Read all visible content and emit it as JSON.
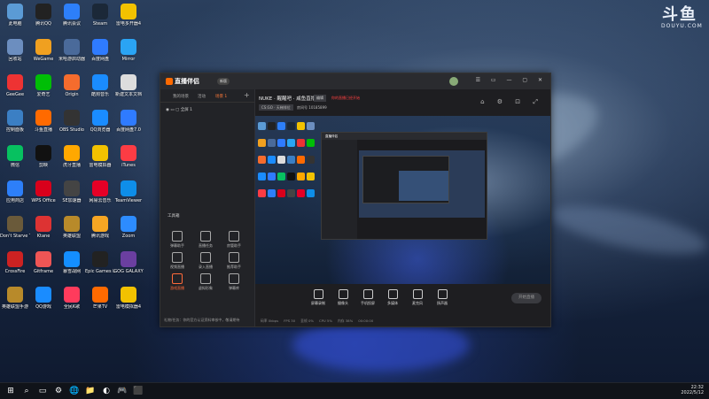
{
  "watermark": {
    "mark": "斗鱼",
    "sub": "DOUYU.COM"
  },
  "desktop_icons": [
    {
      "label": "此电脑",
      "color": "#5b9bd5"
    },
    {
      "label": "腾讯QQ",
      "color": "#222"
    },
    {
      "label": "腾讯会议",
      "color": "#2d7ff9"
    },
    {
      "label": "Steam",
      "color": "#1b2838"
    },
    {
      "label": "雷电多开器4",
      "color": "#f2c200"
    },
    {
      "label": "回收站",
      "color": "#6c8ebf"
    },
    {
      "label": "WeGame",
      "color": "#f0a020"
    },
    {
      "label": "米哈游启动器",
      "color": "#4a6a9a"
    },
    {
      "label": "百度网盘",
      "color": "#2f7bff"
    },
    {
      "label": "Mirror",
      "color": "#2aa4f4"
    },
    {
      "label": "GeeGee",
      "color": "#e33"
    },
    {
      "label": "爱奇艺",
      "color": "#00be06"
    },
    {
      "label": "Origin",
      "color": "#f56c2d"
    },
    {
      "label": "酷狗音乐",
      "color": "#1a8cff"
    },
    {
      "label": "新建文本文档",
      "color": "#ddd"
    },
    {
      "label": "控制面板",
      "color": "#3b7fc4"
    },
    {
      "label": "斗鱼直播",
      "color": "#ff6a00"
    },
    {
      "label": "OBS Studio",
      "color": "#333"
    },
    {
      "label": "QQ浏览器",
      "color": "#1a8cff"
    },
    {
      "label": "百度网盘7.0",
      "color": "#2f7bff"
    },
    {
      "label": "微信",
      "color": "#07c160"
    },
    {
      "label": "剪映",
      "color": "#111"
    },
    {
      "label": "虎牙直播",
      "color": "#ffa800"
    },
    {
      "label": "雷电模拟器",
      "color": "#f2c200"
    },
    {
      "label": "iTunes",
      "color": "#fc3c44"
    },
    {
      "label": "应用商店",
      "color": "#2d7ff9"
    },
    {
      "label": "WPS Office",
      "color": "#d9001b"
    },
    {
      "label": "SE加速器",
      "color": "#444"
    },
    {
      "label": "网易云音乐",
      "color": "#e60026"
    },
    {
      "label": "TeamViewer",
      "color": "#0e8ee9"
    },
    {
      "label": "Don't Starve Together",
      "color": "#6a5a3a"
    },
    {
      "label": "Ktane",
      "color": "#d33"
    },
    {
      "label": "英雄联盟",
      "color": "#b88a2a"
    },
    {
      "label": "腾讯游戏",
      "color": "#f6a623"
    },
    {
      "label": "Zoom",
      "color": "#2d8cff"
    },
    {
      "label": "CrossFire",
      "color": "#c22"
    },
    {
      "label": "Gitframe",
      "color": "#e55"
    },
    {
      "label": "暴雪战网",
      "color": "#148eff"
    },
    {
      "label": "Epic Games Launcher",
      "color": "#222"
    },
    {
      "label": "GOG GALAXY",
      "color": "#6b3fa0"
    },
    {
      "label": "英雄联盟手游",
      "color": "#b88a2a"
    },
    {
      "label": "QQ游戏",
      "color": "#1a8cff"
    },
    {
      "label": "全民K歌",
      "color": "#ff3b5c"
    },
    {
      "label": "芒果TV",
      "color": "#ff6a00"
    },
    {
      "label": "雷电模拟器4",
      "color": "#f2c200"
    }
  ],
  "app": {
    "logo": "直播伴侣",
    "version": "新版",
    "tabs": [
      "我的场景",
      "活动",
      "场景 1"
    ],
    "scene_label": "全屏 1",
    "tools_title": "工具箱",
    "tools": [
      {
        "label": "弹幕助手"
      },
      {
        "label": "直播任务"
      },
      {
        "label": "房管助手"
      },
      {
        "label": "视频直播"
      },
      {
        "label": "录入直播"
      },
      {
        "label": "推荐助手"
      },
      {
        "label": "游戏直播"
      },
      {
        "label": "虚拟形象"
      },
      {
        "label": "弹幕库"
      }
    ],
    "status_text": "礼物/任务：你的官方认证资料审核中，敬请期待",
    "room_title": "NUKE · 醒醒吧 · 咸鱼直播",
    "edit_label": "编辑",
    "warning_text": "你的直播已经开始",
    "category_chip": "CS:GO · 天梯排位",
    "room_info": "房间号 10185899",
    "bottom_buttons": [
      {
        "label": "屏幕录制"
      },
      {
        "label": "摄像头"
      },
      {
        "label": "手机投屏"
      },
      {
        "label": "多媒体"
      },
      {
        "label": "麦克风"
      },
      {
        "label": "扬声器"
      }
    ],
    "start_label": "开始直播",
    "footer_items": [
      "码率 0kbps",
      "FPS 30",
      "丢帧 0%",
      "CPU 5%",
      "内存 38%",
      "00:00:00"
    ]
  },
  "taskbar": {
    "time": "22:32",
    "date": "2022/5/12",
    "items": [
      "⊞",
      "⌕",
      "▭",
      "⚙",
      "🌐",
      "📁",
      "◐",
      "🎮",
      "⬛"
    ]
  }
}
